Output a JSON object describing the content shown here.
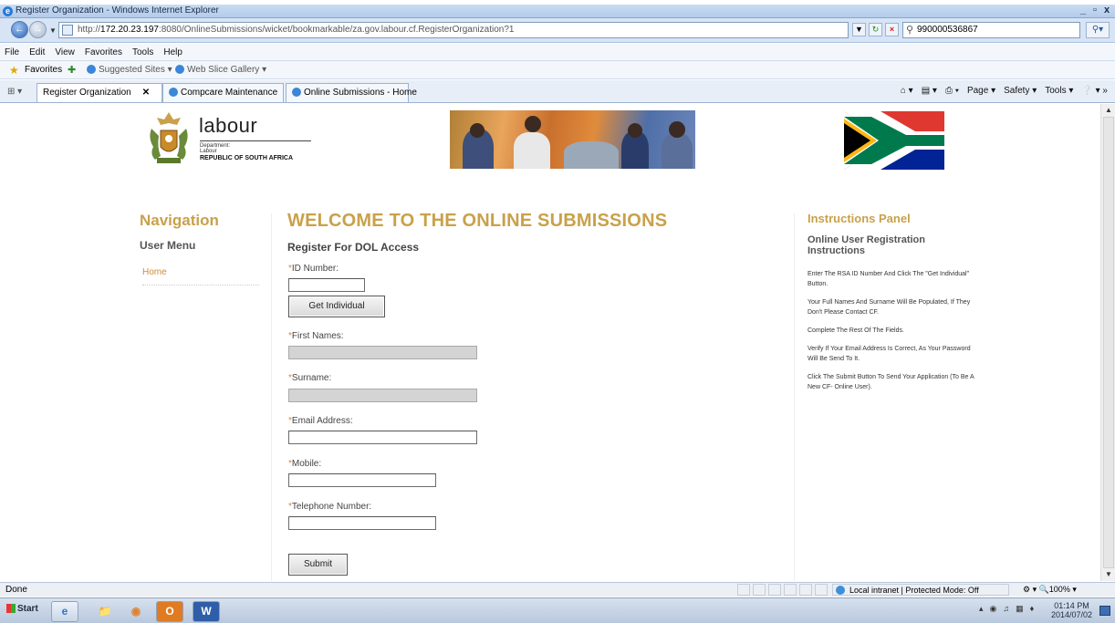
{
  "window": {
    "title": "Register Organization - Windows Internet Explorer",
    "controls": [
      "_",
      "ȸ",
      "x"
    ]
  },
  "address": {
    "url_prefix": "http://",
    "url_host": "172.20.23.197",
    "url_rest": ":8080/OnlineSubmissions/wicket/bookmarkable/za.gov.labour.cf.RegisterOrganization?1",
    "search_value": "990000536867"
  },
  "menu": [
    "File",
    "Edit",
    "View",
    "Favorites",
    "Tools",
    "Help"
  ],
  "favorites_bar": {
    "label": "Favorites",
    "item1": "Suggested Sites ▾",
    "item2": "Web Slice Gallery ▾"
  },
  "tabs": [
    {
      "label": "Register Organization"
    },
    {
      "label": "Compcare Maintenance"
    },
    {
      "label": "Online Submissions - Home"
    }
  ],
  "command_bar": {
    "page": "Page ▾",
    "safety": "Safety ▾",
    "tools": "Tools ▾"
  },
  "header": {
    "logo_word": "labour",
    "logo_dept": "Department:",
    "logo_dept2": "Labour",
    "logo_country": "REPUBLIC OF SOUTH AFRICA"
  },
  "navigation": {
    "title": "Navigation",
    "user_menu": "User Menu",
    "home": "Home"
  },
  "main": {
    "welcome": "WELCOME TO THE ONLINE SUBMISSIONS",
    "register": "Register For DOL Access",
    "id_label": "ID Number:",
    "get_individual": "Get Individual",
    "first_names_label": "First Names:",
    "surname_label": "Surname:",
    "email_label": "Email Address:",
    "mobile_label": "Mobile:",
    "telephone_label": "Telephone Number:",
    "submit": "Submit",
    "required_mark": "*"
  },
  "instructions": {
    "title": "Instructions Panel",
    "subtitle": "Online User Registration Instructions",
    "p1": "Enter The RSA ID Number And Click The \"Get Individual\" Button.",
    "p2": "Your Full Names And Surname Will Be Populated, If They Don't Please Contact CF.",
    "p3": "Complete The Rest Of The Fields.",
    "p4": "Verify If Your Email Address Is Correct, As Your Password Will Be Send To It.",
    "p5": "Click The Submit Button To Send Your Application (To Be A New CF- Online User)."
  },
  "status": {
    "done": "Done",
    "zone": "Local intranet | Protected Mode: Off",
    "zoom": "100%"
  },
  "taskbar": {
    "start": "Start",
    "time": "01:14 PM",
    "date": "2014/07/02"
  },
  "colors": {
    "heading_gold": "#c9a14a",
    "link_orange": "#d18a3a"
  }
}
